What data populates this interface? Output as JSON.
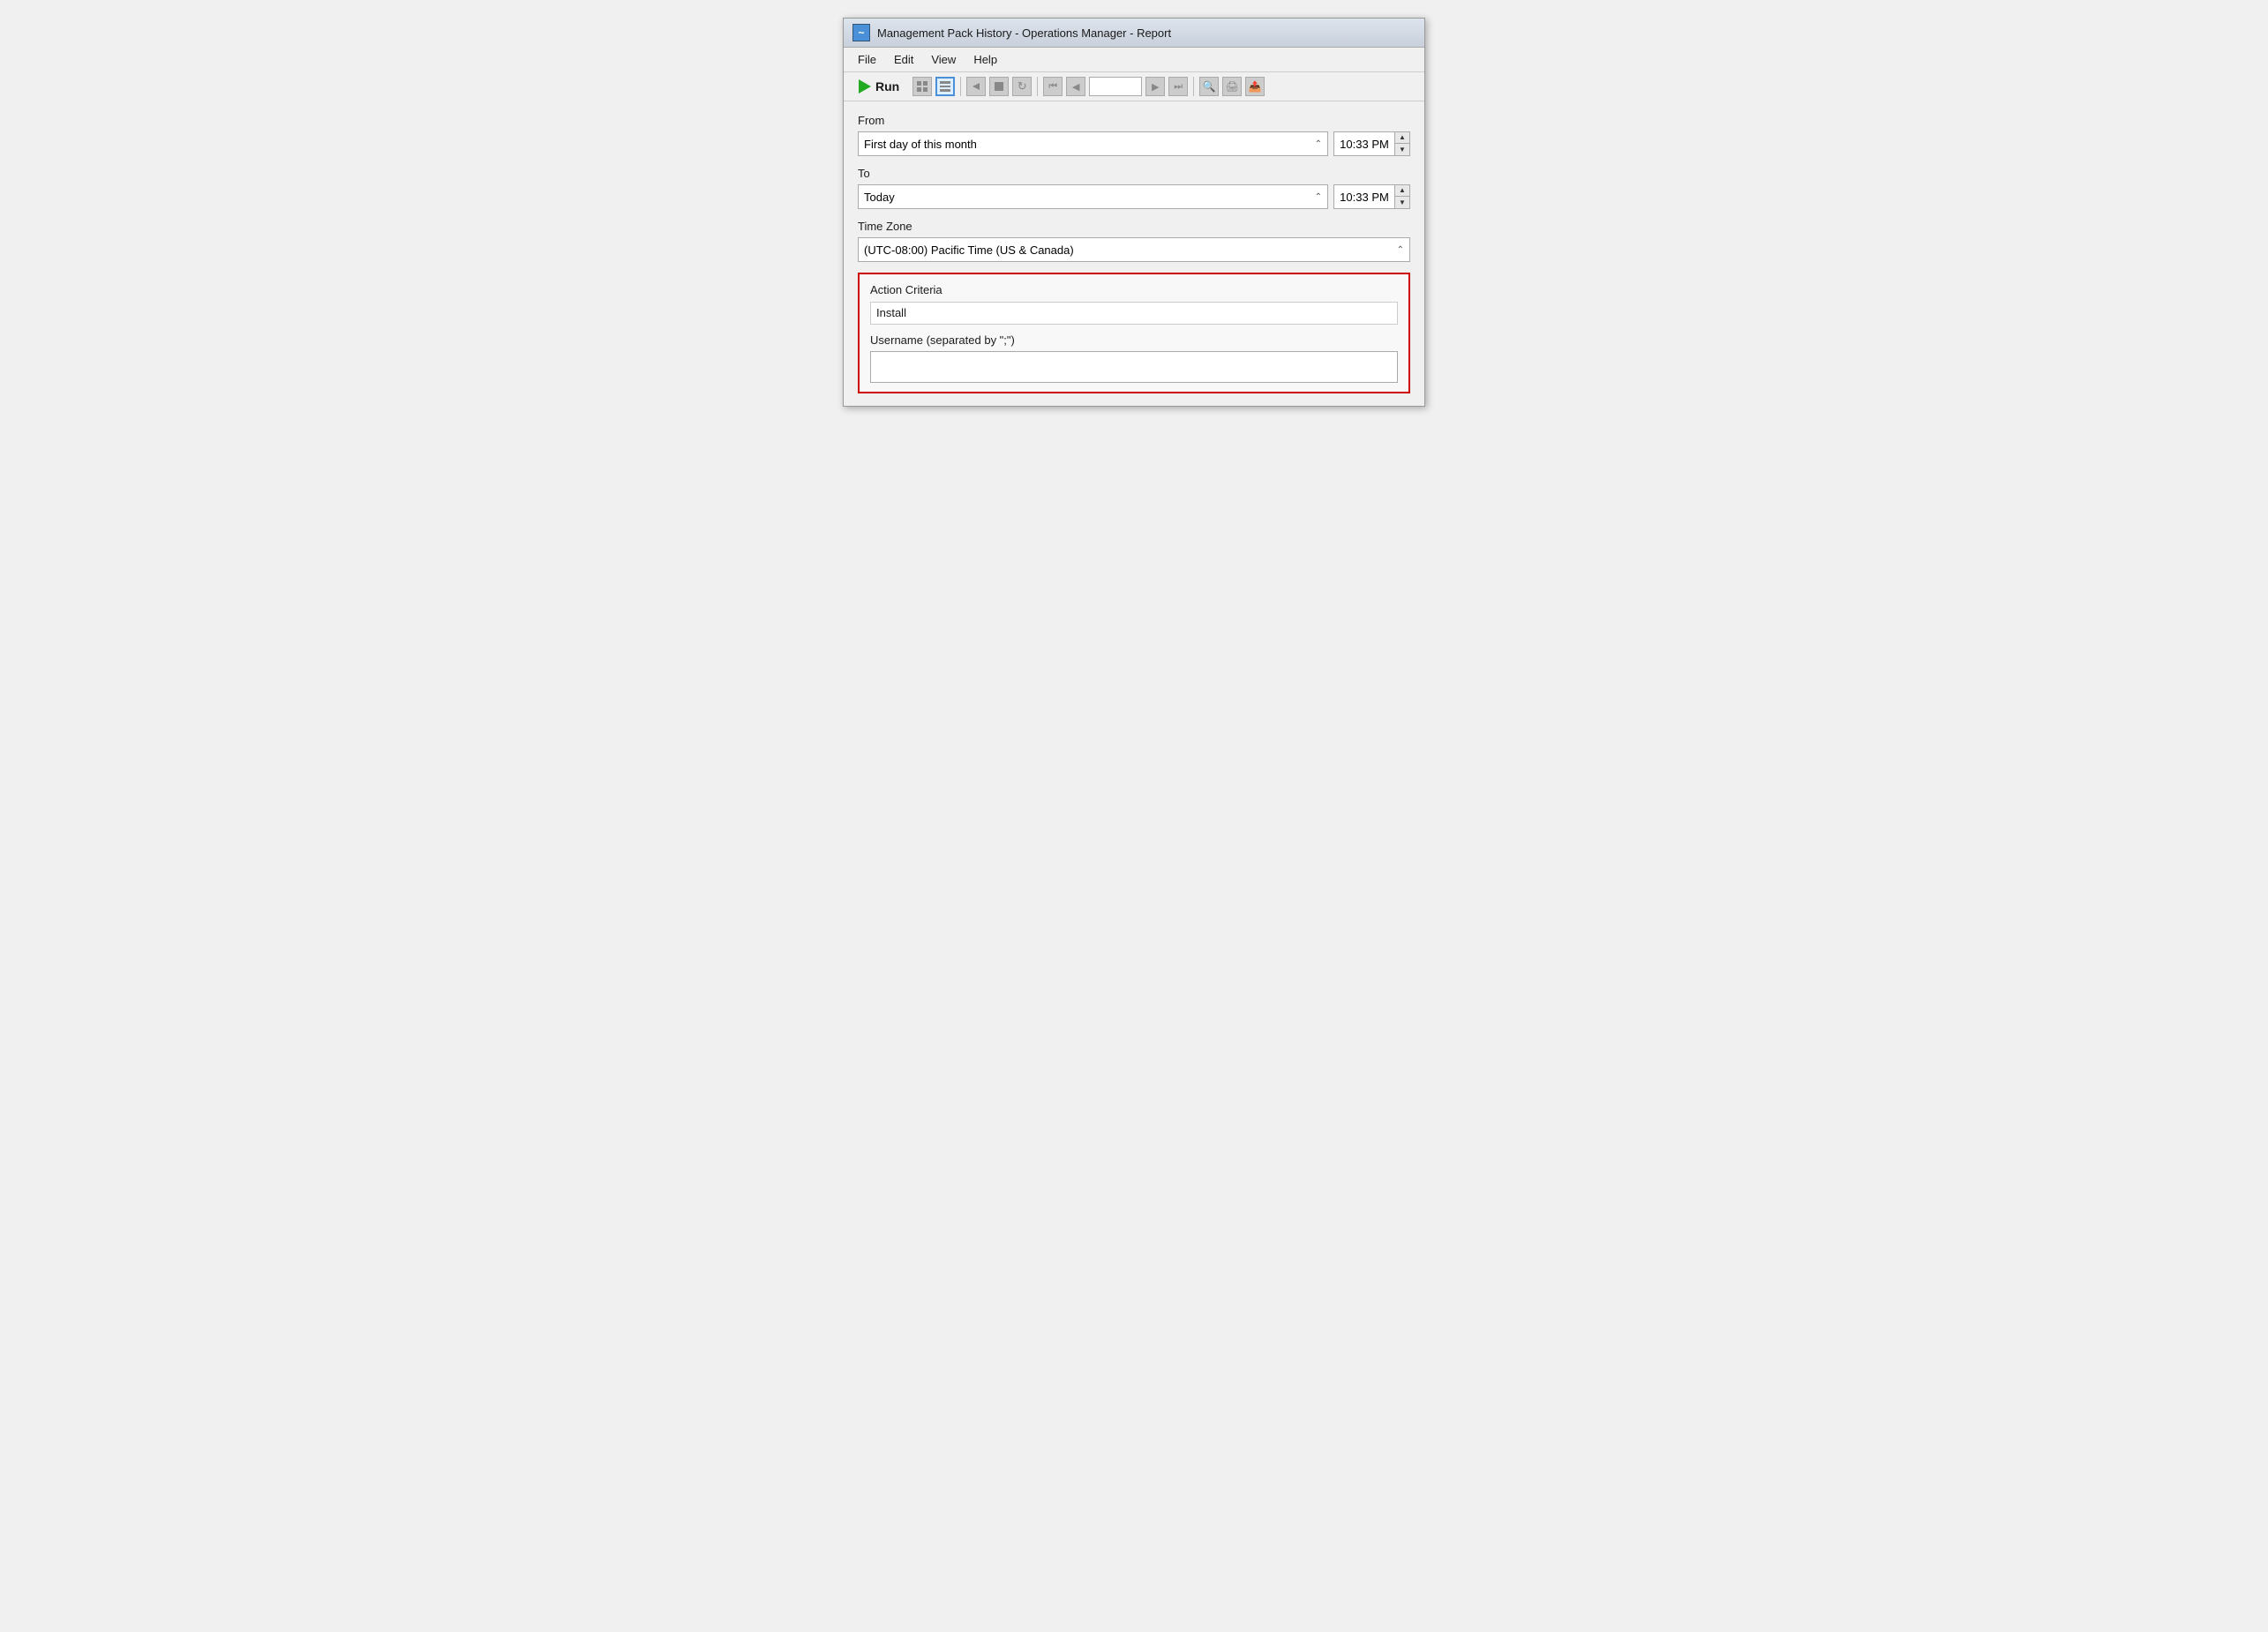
{
  "window": {
    "title": "Management Pack History - Operations Manager - Report",
    "icon": "~"
  },
  "menu": {
    "items": [
      "File",
      "Edit",
      "View",
      "Help"
    ]
  },
  "toolbar": {
    "run_label": "Run",
    "page_value": "",
    "buttons": [
      {
        "id": "run",
        "label": "Run"
      },
      {
        "id": "grid",
        "icon": "grid-icon"
      },
      {
        "id": "layout",
        "icon": "layout-icon"
      },
      {
        "id": "back",
        "icon": "back-icon"
      },
      {
        "id": "stop",
        "icon": "stop-icon"
      },
      {
        "id": "refresh",
        "icon": "refresh-icon"
      },
      {
        "id": "first",
        "icon": "first-icon"
      },
      {
        "id": "prev",
        "icon": "prev-icon"
      },
      {
        "id": "next",
        "icon": "next-icon"
      },
      {
        "id": "last",
        "icon": "last-icon"
      },
      {
        "id": "zoom",
        "icon": "zoom-icon"
      },
      {
        "id": "print",
        "icon": "print-icon"
      },
      {
        "id": "export",
        "icon": "export-icon"
      }
    ]
  },
  "form": {
    "from_label": "From",
    "from_dropdown": "First day of this month",
    "from_time": "10:33 PM",
    "to_label": "To",
    "to_dropdown": "Today",
    "to_time": "10:33 PM",
    "timezone_label": "Time Zone",
    "timezone_value": "(UTC-08:00) Pacific Time (US & Canada)",
    "action_criteria_label": "Action Criteria",
    "action_criteria_value": "Install",
    "username_label": "Username (separated by \";\")",
    "username_value": ""
  }
}
